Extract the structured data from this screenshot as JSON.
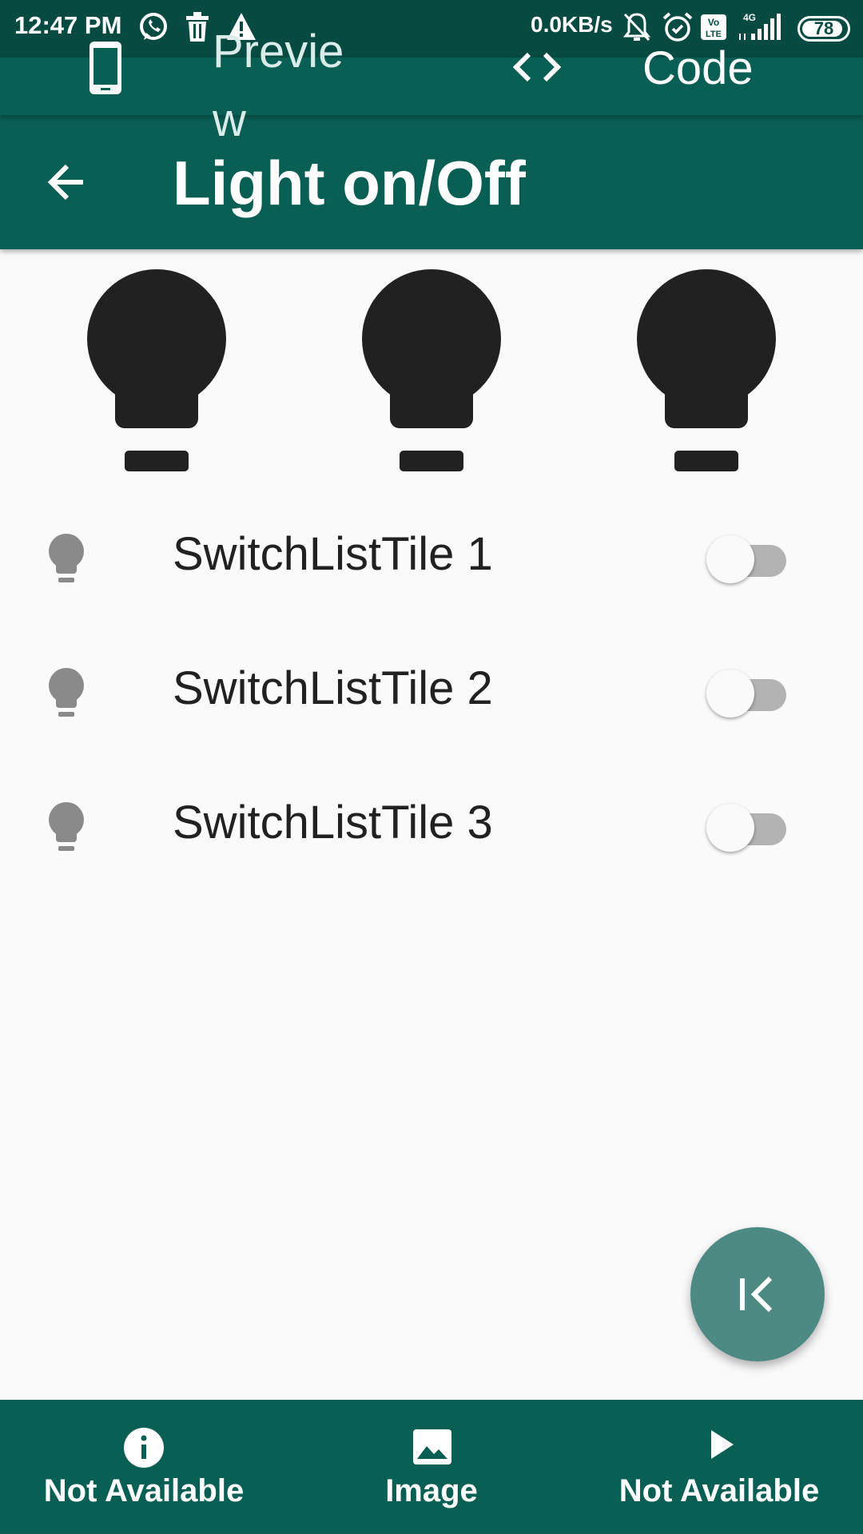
{
  "status_bar": {
    "time": "12:47 PM",
    "network_speed": "0.0KB/s",
    "network_type": "4G",
    "volte": "Vo LTE",
    "battery": "78",
    "icons": [
      "whatsapp-icon",
      "delete-icon",
      "warning-icon",
      "muted-bell-icon",
      "alarm-icon",
      "volte-icon",
      "signal-icon",
      "battery-icon"
    ]
  },
  "tab_bar": {
    "preview_label": "Preview",
    "code_label": "Code"
  },
  "app_bar": {
    "title": "Light on/Off"
  },
  "bulbs": [
    {
      "icon": "lightbulb-icon",
      "on": false
    },
    {
      "icon": "lightbulb-icon",
      "on": false
    },
    {
      "icon": "lightbulb-icon",
      "on": false
    }
  ],
  "tiles": [
    {
      "label": "SwitchListTile 1",
      "on": false
    },
    {
      "label": "SwitchListTile 2",
      "on": false
    },
    {
      "label": "SwitchListTile 3",
      "on": false
    }
  ],
  "fab": {
    "icon": "collapse-left-icon"
  },
  "bottom_nav": [
    {
      "label": "Not Available",
      "icon": "info-icon"
    },
    {
      "label": "Image",
      "icon": "image-icon"
    },
    {
      "label": "Not Available",
      "icon": "play-icon"
    }
  ],
  "colors": {
    "primary": "#0a5f55",
    "status_bar": "#064a42",
    "bulb_off": "#212121",
    "tile_icon": "#8a8a8a",
    "fab": "#4e8a84"
  }
}
